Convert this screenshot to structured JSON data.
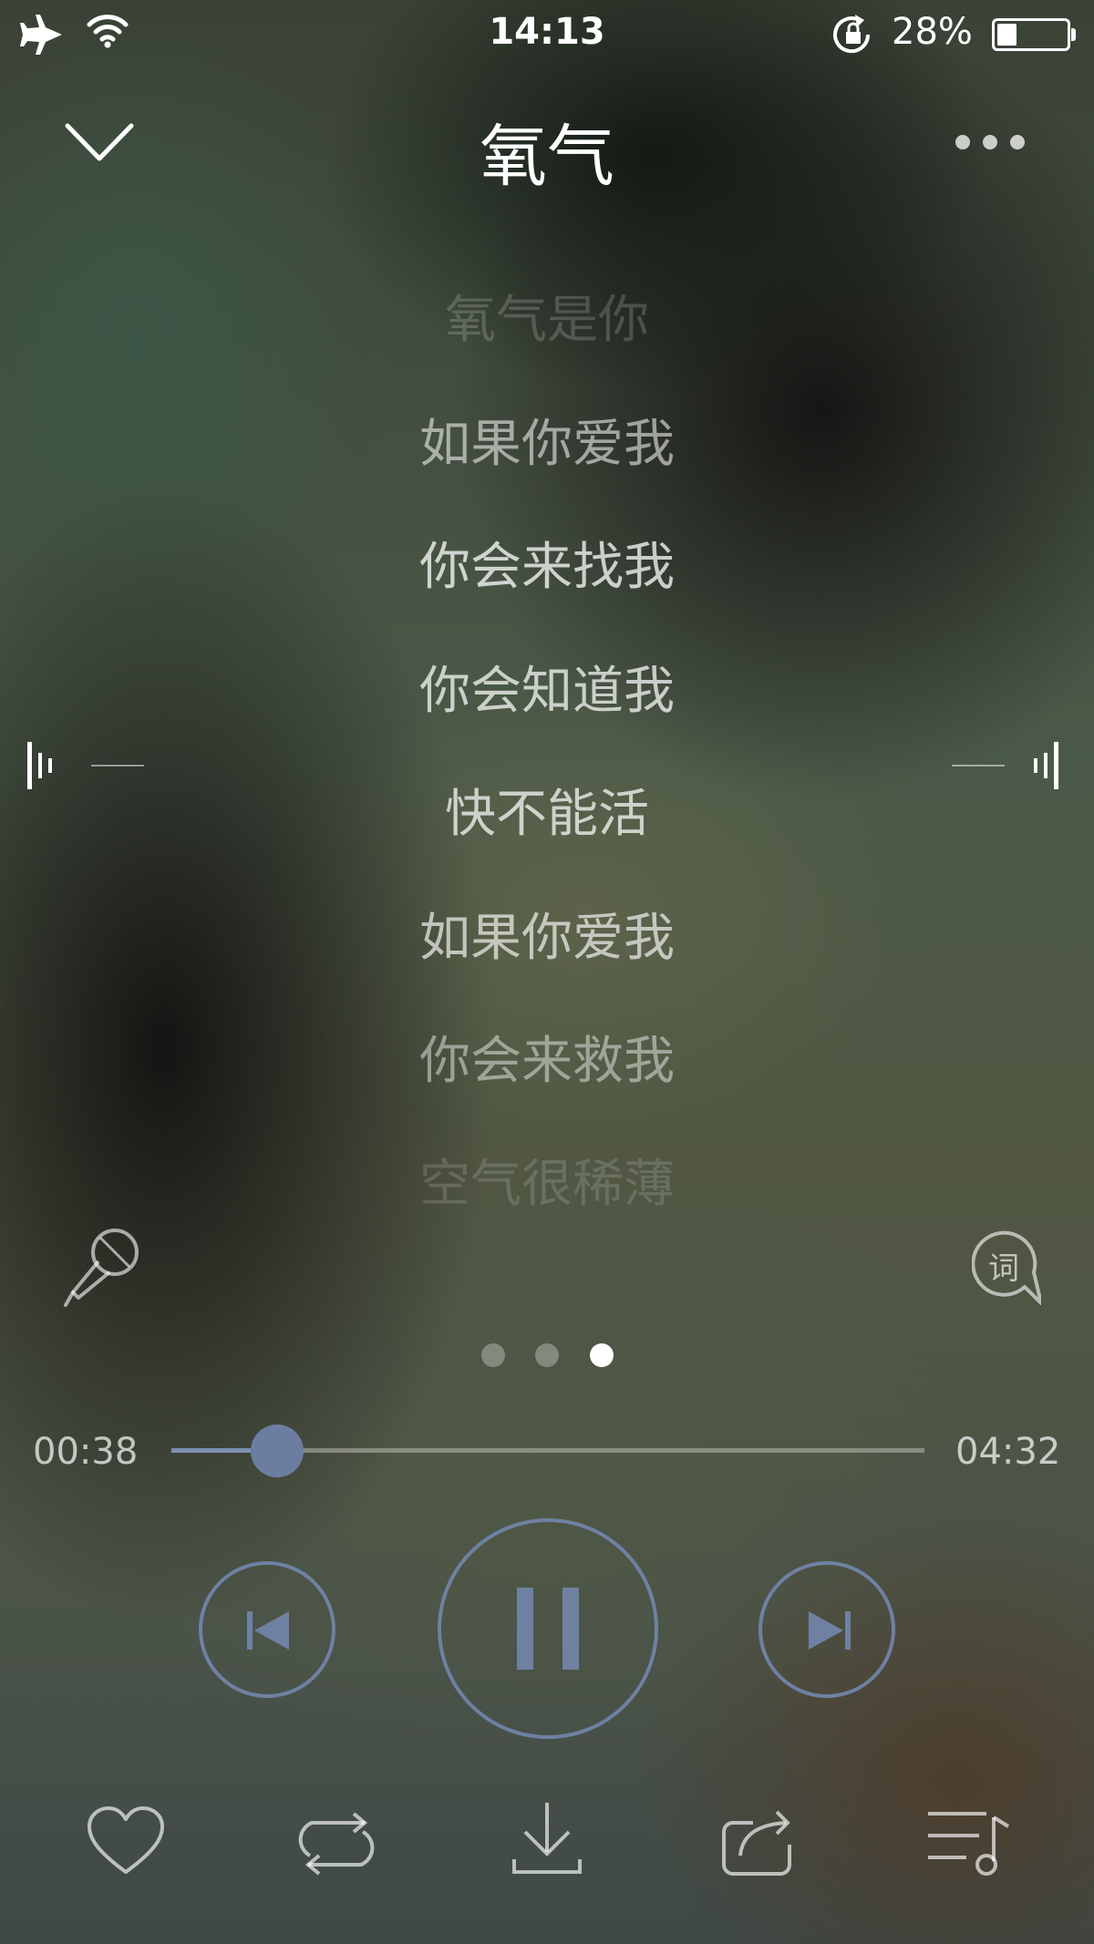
{
  "status_bar": {
    "time": "14:13",
    "battery_percent": "28%",
    "battery_level": 0.28,
    "icons": [
      "airplane-icon",
      "wifi-icon",
      "rotation-lock-icon",
      "battery-icon"
    ]
  },
  "header": {
    "title": "氧气",
    "collapse_icon": "chevron-down-icon",
    "more_icon": "more-icon"
  },
  "lyrics": [
    "氧气是你",
    "如果你爱我",
    "你会来找我",
    "你会知道我",
    "快不能活",
    "如果你爱我",
    "你会来救我",
    "空气很稀薄"
  ],
  "tools": {
    "karaoke_icon": "microphone-icon",
    "lyrics_toggle_label": "词"
  },
  "pager": {
    "count": 3,
    "active_index": 2
  },
  "progress": {
    "elapsed": "00:38",
    "total": "04:32",
    "fraction": 0.14
  },
  "controls": [
    "previous-icon",
    "pause-icon",
    "next-icon"
  ],
  "bottom_bar": [
    "heart-icon",
    "repeat-icon",
    "download-icon",
    "share-icon",
    "playlist-icon"
  ],
  "colors": {
    "accent": "#6f81a3",
    "text": "#ffffff"
  }
}
